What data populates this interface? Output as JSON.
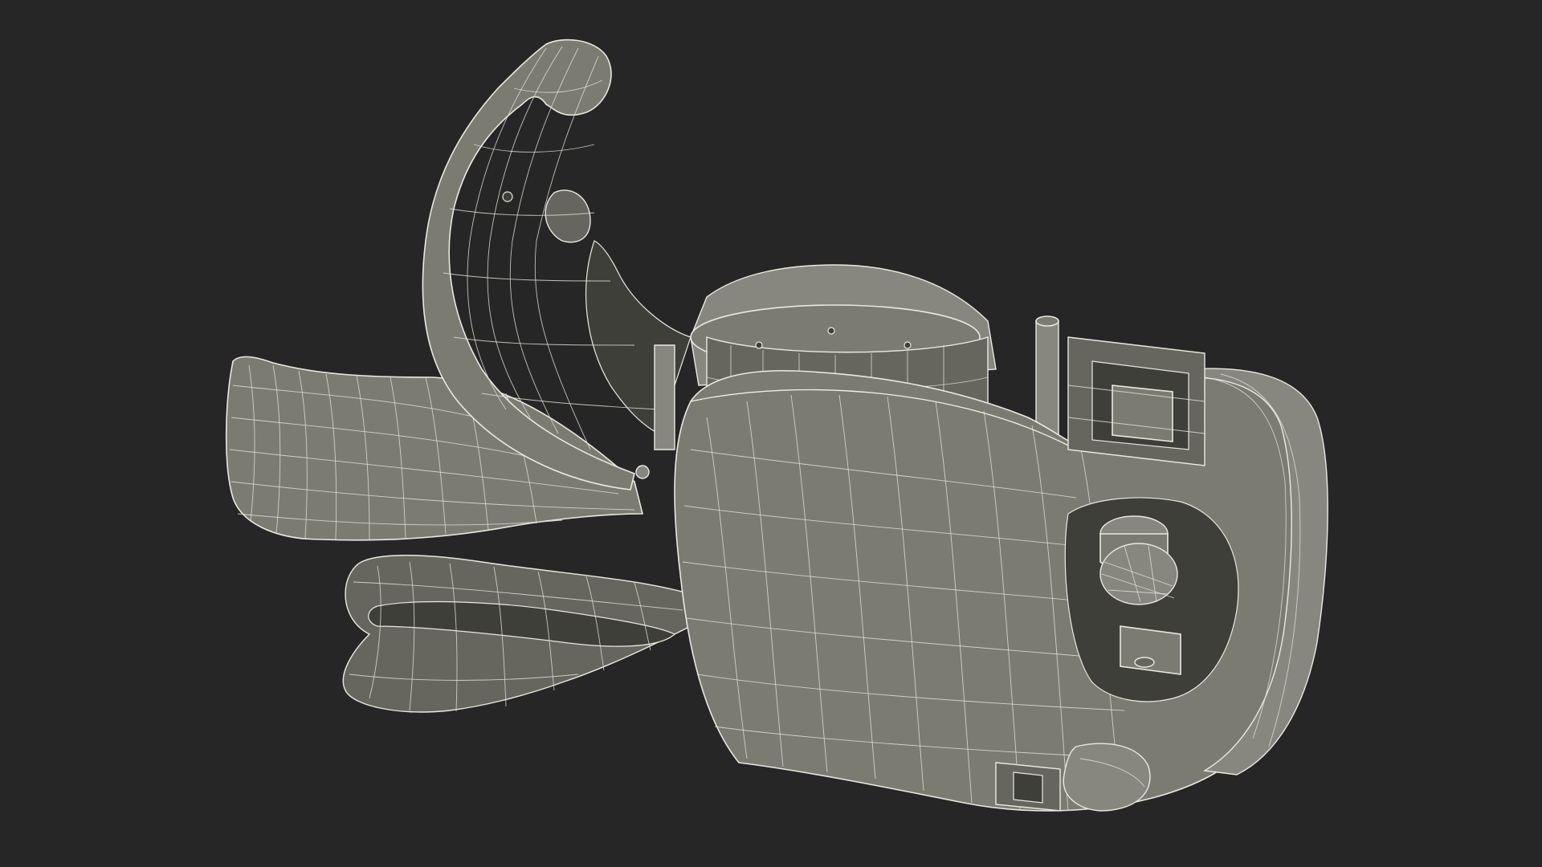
{
  "scene": {
    "background_color": "#262626",
    "mesh_fill_color": "#7b7b72",
    "mesh_dark_color": "#66665e",
    "wire_color": "#e9e9e1"
  }
}
